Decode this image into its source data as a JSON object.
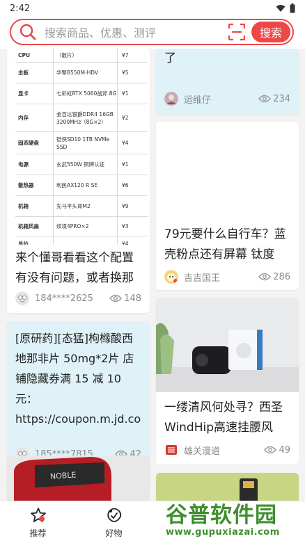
{
  "status_bar": {
    "time": "2:42"
  },
  "search": {
    "placeholder": "搜索商品、优惠、测评",
    "button_label": "搜索"
  },
  "spec_table": [
    {
      "key": "CPU",
      "value": "（散片）",
      "price": "¥7"
    },
    {
      "key": "主板",
      "value": "华擎B550M-HDV",
      "price": "¥5"
    },
    {
      "key": "显卡",
      "value": "七彩虹RTX 5060战斧 8G",
      "price": "¥1"
    },
    {
      "key": "内存",
      "value": "金百达银爵DDR4 16GB 3200MHz（8G×2）",
      "price": "¥2"
    },
    {
      "key": "固态硬盘",
      "value": "铠侠SD10 1TB NVMe SSD",
      "price": "¥4"
    },
    {
      "key": "电源",
      "value": "玄武550W 铜牌认证",
      "price": "¥1"
    },
    {
      "key": "散热器",
      "value": "利民AX120 R SE",
      "price": "¥6"
    },
    {
      "key": "机箱",
      "value": "先马平头哥M2",
      "price": "¥9"
    },
    {
      "key": "机箱风扇",
      "value": "续境4PRO×2",
      "price": "¥3"
    },
    {
      "key": "总价",
      "value": "",
      "price": "¥4"
    }
  ],
  "cards": {
    "pc_build": {
      "title": "来个懂哥看看这个配置有没有问题，或者换那个…",
      "author": "184****2625",
      "views": "148"
    },
    "top_right": {
      "title": "了",
      "author": "运维仔",
      "views": "234"
    },
    "bike": {
      "title": "79元要什么自行车？蓝壳粉点还有屏幕 钛度6…",
      "author": "吉吉国王",
      "views": "286"
    },
    "coupon": {
      "title": "[原研药][态猛]枸橼酸西地那非片 50mg*2片 店铺隐藏券满 15 减 10 元：https://coupon.m.jd.com/cou…",
      "author": "185****7815",
      "views": "42"
    },
    "fan": {
      "title": "一缕清风何处寻？西圣WindHip高速挂腰风扇…",
      "author": "雄关漫道",
      "views": "49"
    }
  },
  "bottom_nav": [
    {
      "label": "推荐",
      "icon": "star-icon"
    },
    {
      "label": "好物",
      "icon": "goods-icon"
    }
  ],
  "watermark": {
    "title": "谷普软件园",
    "url": "www.gupuxiazai.com"
  },
  "colors": {
    "accent": "#ee4747",
    "text_card_bg": "#dff2f7",
    "watermark": "#3f8f2e"
  }
}
